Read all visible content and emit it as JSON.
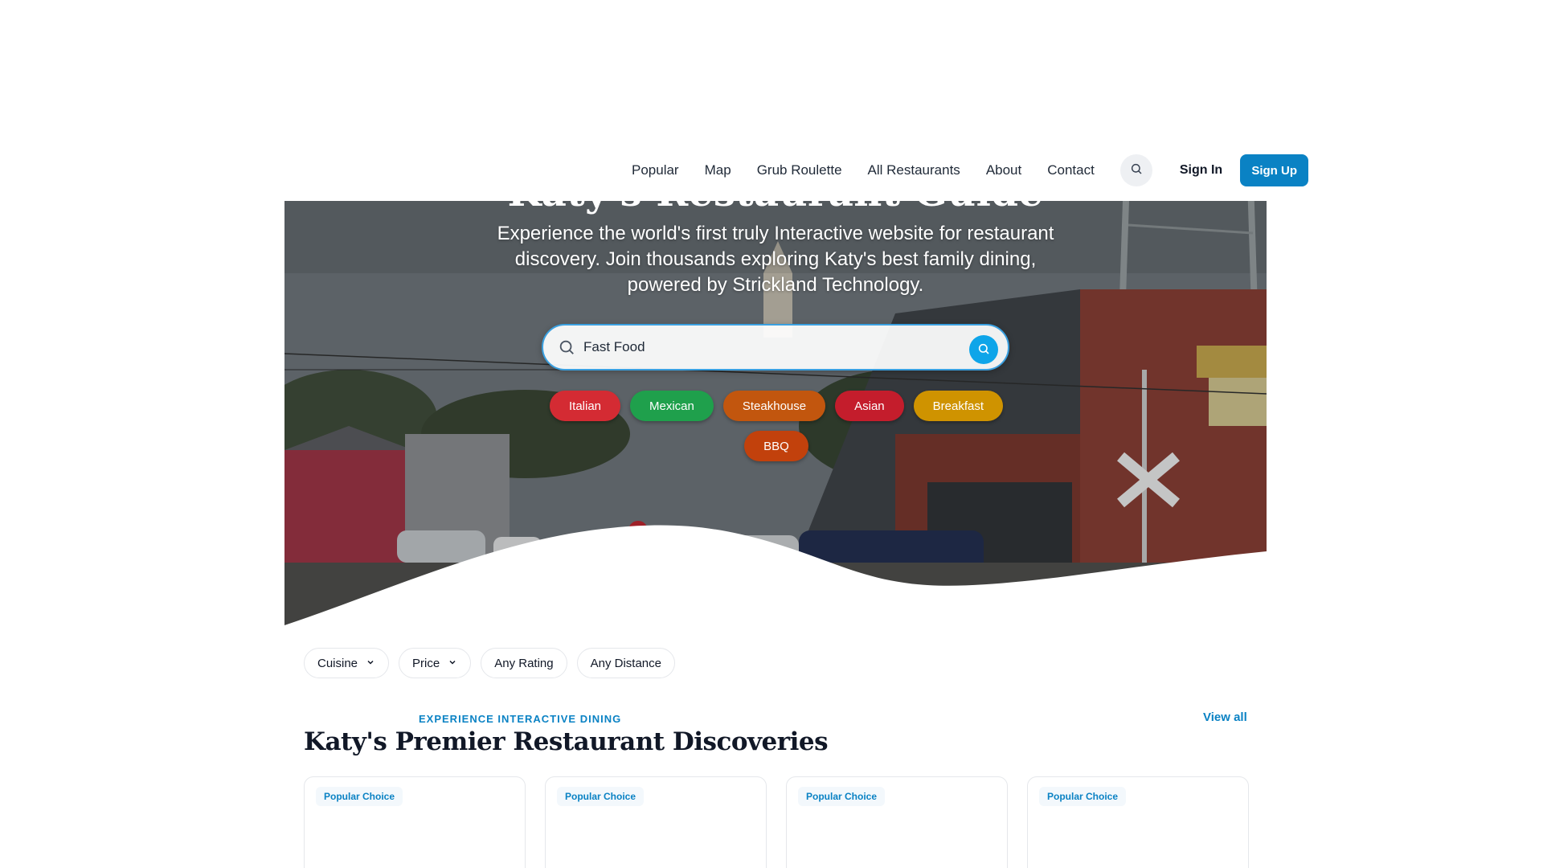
{
  "nav": {
    "links": [
      "Popular",
      "Map",
      "Grub Roulette",
      "All Restaurants",
      "About",
      "Contact"
    ],
    "sign_in": "Sign In",
    "sign_up": "Sign Up"
  },
  "hero": {
    "title": "Katy's Restaurant Guide",
    "subtitle": "Experience the world's first truly Interactive website for restaurant discovery. Join thousands exploring Katy's best family dining, powered by Strickland Technology.",
    "search": {
      "value": "Fast Food"
    },
    "chips": [
      {
        "label": "Italian",
        "color": "#d42b33"
      },
      {
        "label": "Mexican",
        "color": "#1fa04c"
      },
      {
        "label": "Steakhouse",
        "color": "#c2560e"
      },
      {
        "label": "Asian",
        "color": "#c41d2c"
      },
      {
        "label": "Breakfast",
        "color": "#cf9300"
      },
      {
        "label": "BBQ",
        "color": "#c2410c"
      }
    ]
  },
  "filters": {
    "cuisine": "Cuisine",
    "price": "Price",
    "rating": "Any Rating",
    "distance": "Any Distance"
  },
  "section": {
    "eyebrow": "EXPERIENCE INTERACTIVE DINING",
    "title": "Katy's Premier Restaurant Discoveries",
    "view_all": "View all",
    "cards": [
      {
        "badge": "Popular Choice"
      },
      {
        "badge": "Popular Choice"
      },
      {
        "badge": "Popular Choice"
      },
      {
        "badge": "Popular Choice"
      }
    ]
  },
  "colors": {
    "accent": "#0a82c4",
    "search_border": "#3aa0e0"
  }
}
